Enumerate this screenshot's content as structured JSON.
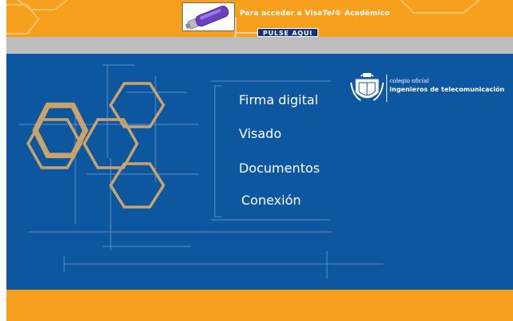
{
  "header": {
    "promo_prefix": "Para acceder a Visa",
    "promo_brand": "Tel",
    "promo_suffix": "® Académico",
    "button_label": "PULSE AQUI"
  },
  "menu": [
    {
      "label": "Firma digital"
    },
    {
      "label": "Visado"
    },
    {
      "label": "Documentos"
    },
    {
      "label": "Conexión"
    }
  ],
  "logo": {
    "line1": "colegio oficial",
    "line2": "ingenieros de telecomunicación"
  },
  "colors": {
    "orange": "#f7a01e",
    "blue": "#0d56a0",
    "gray": "#bdbdbd",
    "hexagon": "#c9a36a",
    "button": "#12327d"
  }
}
